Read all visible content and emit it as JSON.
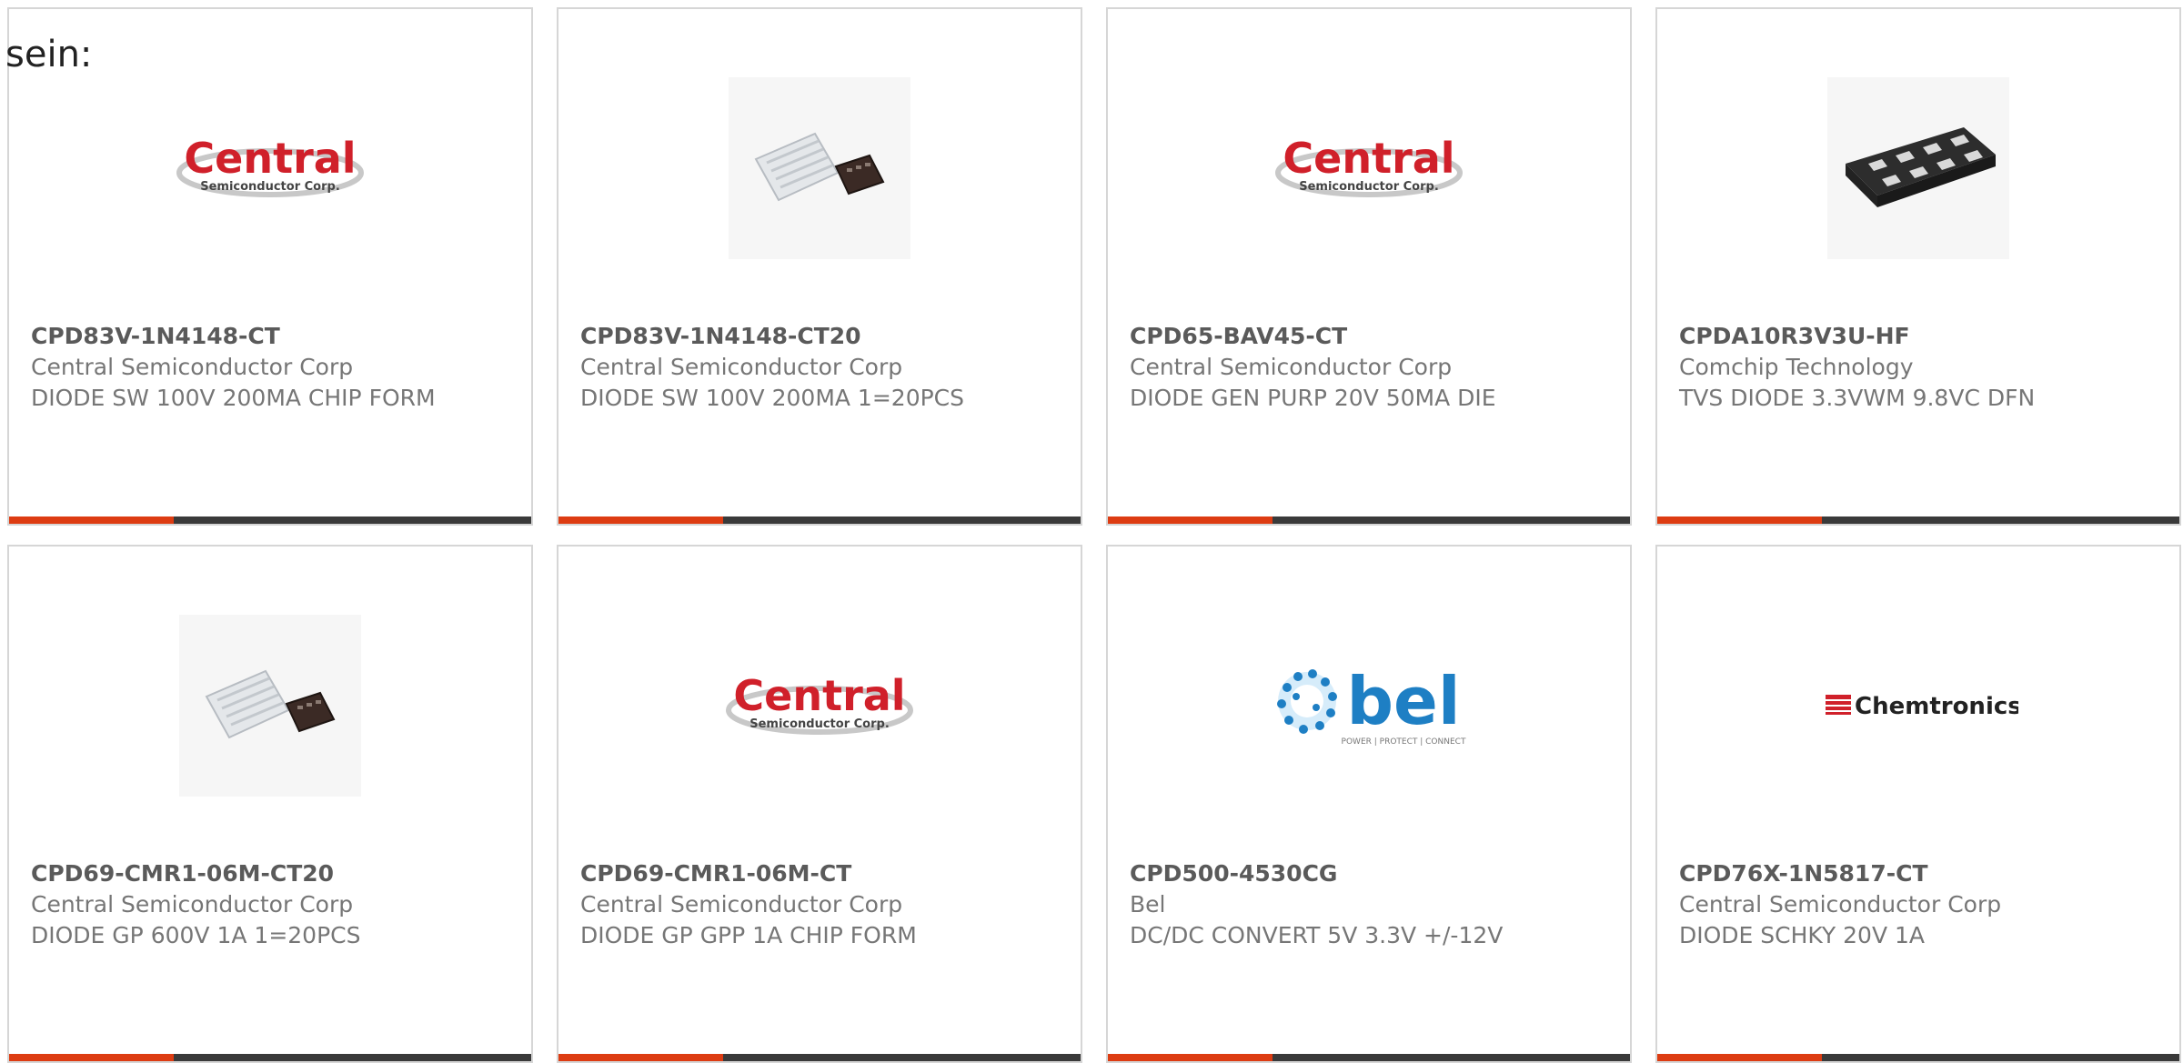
{
  "intro_text": "sein:",
  "colors": {
    "accent_bar": "#dd3c12",
    "dark_bar": "#3a3a3a",
    "card_border": "#d6d6d6",
    "text": "#767676"
  },
  "products": [
    {
      "part_number": "CPD83V-1N4148-CT",
      "manufacturer": "Central Semiconductor Corp",
      "description": "DIODE SW 100V 200MA CHIP FORM",
      "image": "central-semiconductor-logo",
      "logo_line1": "Central",
      "logo_line2": "Semiconductor Corp."
    },
    {
      "part_number": "CPD83V-1N4148-CT20",
      "manufacturer": "Central Semiconductor Corp",
      "description": "DIODE SW 100V 200MA 1=20PCS",
      "image": "chip-waffle-pack-photo"
    },
    {
      "part_number": "CPD65-BAV45-CT",
      "manufacturer": "Central Semiconductor Corp",
      "description": "DIODE GEN PURP 20V 50MA DIE",
      "image": "central-semiconductor-logo",
      "logo_line1": "Central",
      "logo_line2": "Semiconductor Corp."
    },
    {
      "part_number": "CPDA10R3V3U-HF",
      "manufacturer": "Comchip Technology",
      "description": "TVS DIODE 3.3VWM 9.8VC DFN",
      "image": "dfn-package-photo"
    },
    {
      "part_number": "CPD69-CMR1-06M-CT20",
      "manufacturer": "Central Semiconductor Corp",
      "description": "DIODE GP 600V 1A 1=20PCS",
      "image": "chip-waffle-pack-photo"
    },
    {
      "part_number": "CPD69-CMR1-06M-CT",
      "manufacturer": "Central Semiconductor Corp",
      "description": "DIODE GP GPP 1A CHIP FORM",
      "image": "central-semiconductor-logo",
      "logo_line1": "Central",
      "logo_line2": "Semiconductor Corp."
    },
    {
      "part_number": "CPD500-4530CG",
      "manufacturer": "Bel",
      "description": "DC/DC CONVERT 5V 3.3V +/-12V",
      "image": "bel-logo",
      "logo_line1": "bel",
      "logo_line2": "POWER | PROTECT | CONNECT"
    },
    {
      "part_number": "CPD76X-1N5817-CT",
      "manufacturer": "Central Semiconductor Corp",
      "description": "DIODE SCHKY 20V 1A",
      "image": "chemtronics-logo",
      "logo_line1": "Chemtronics"
    }
  ]
}
